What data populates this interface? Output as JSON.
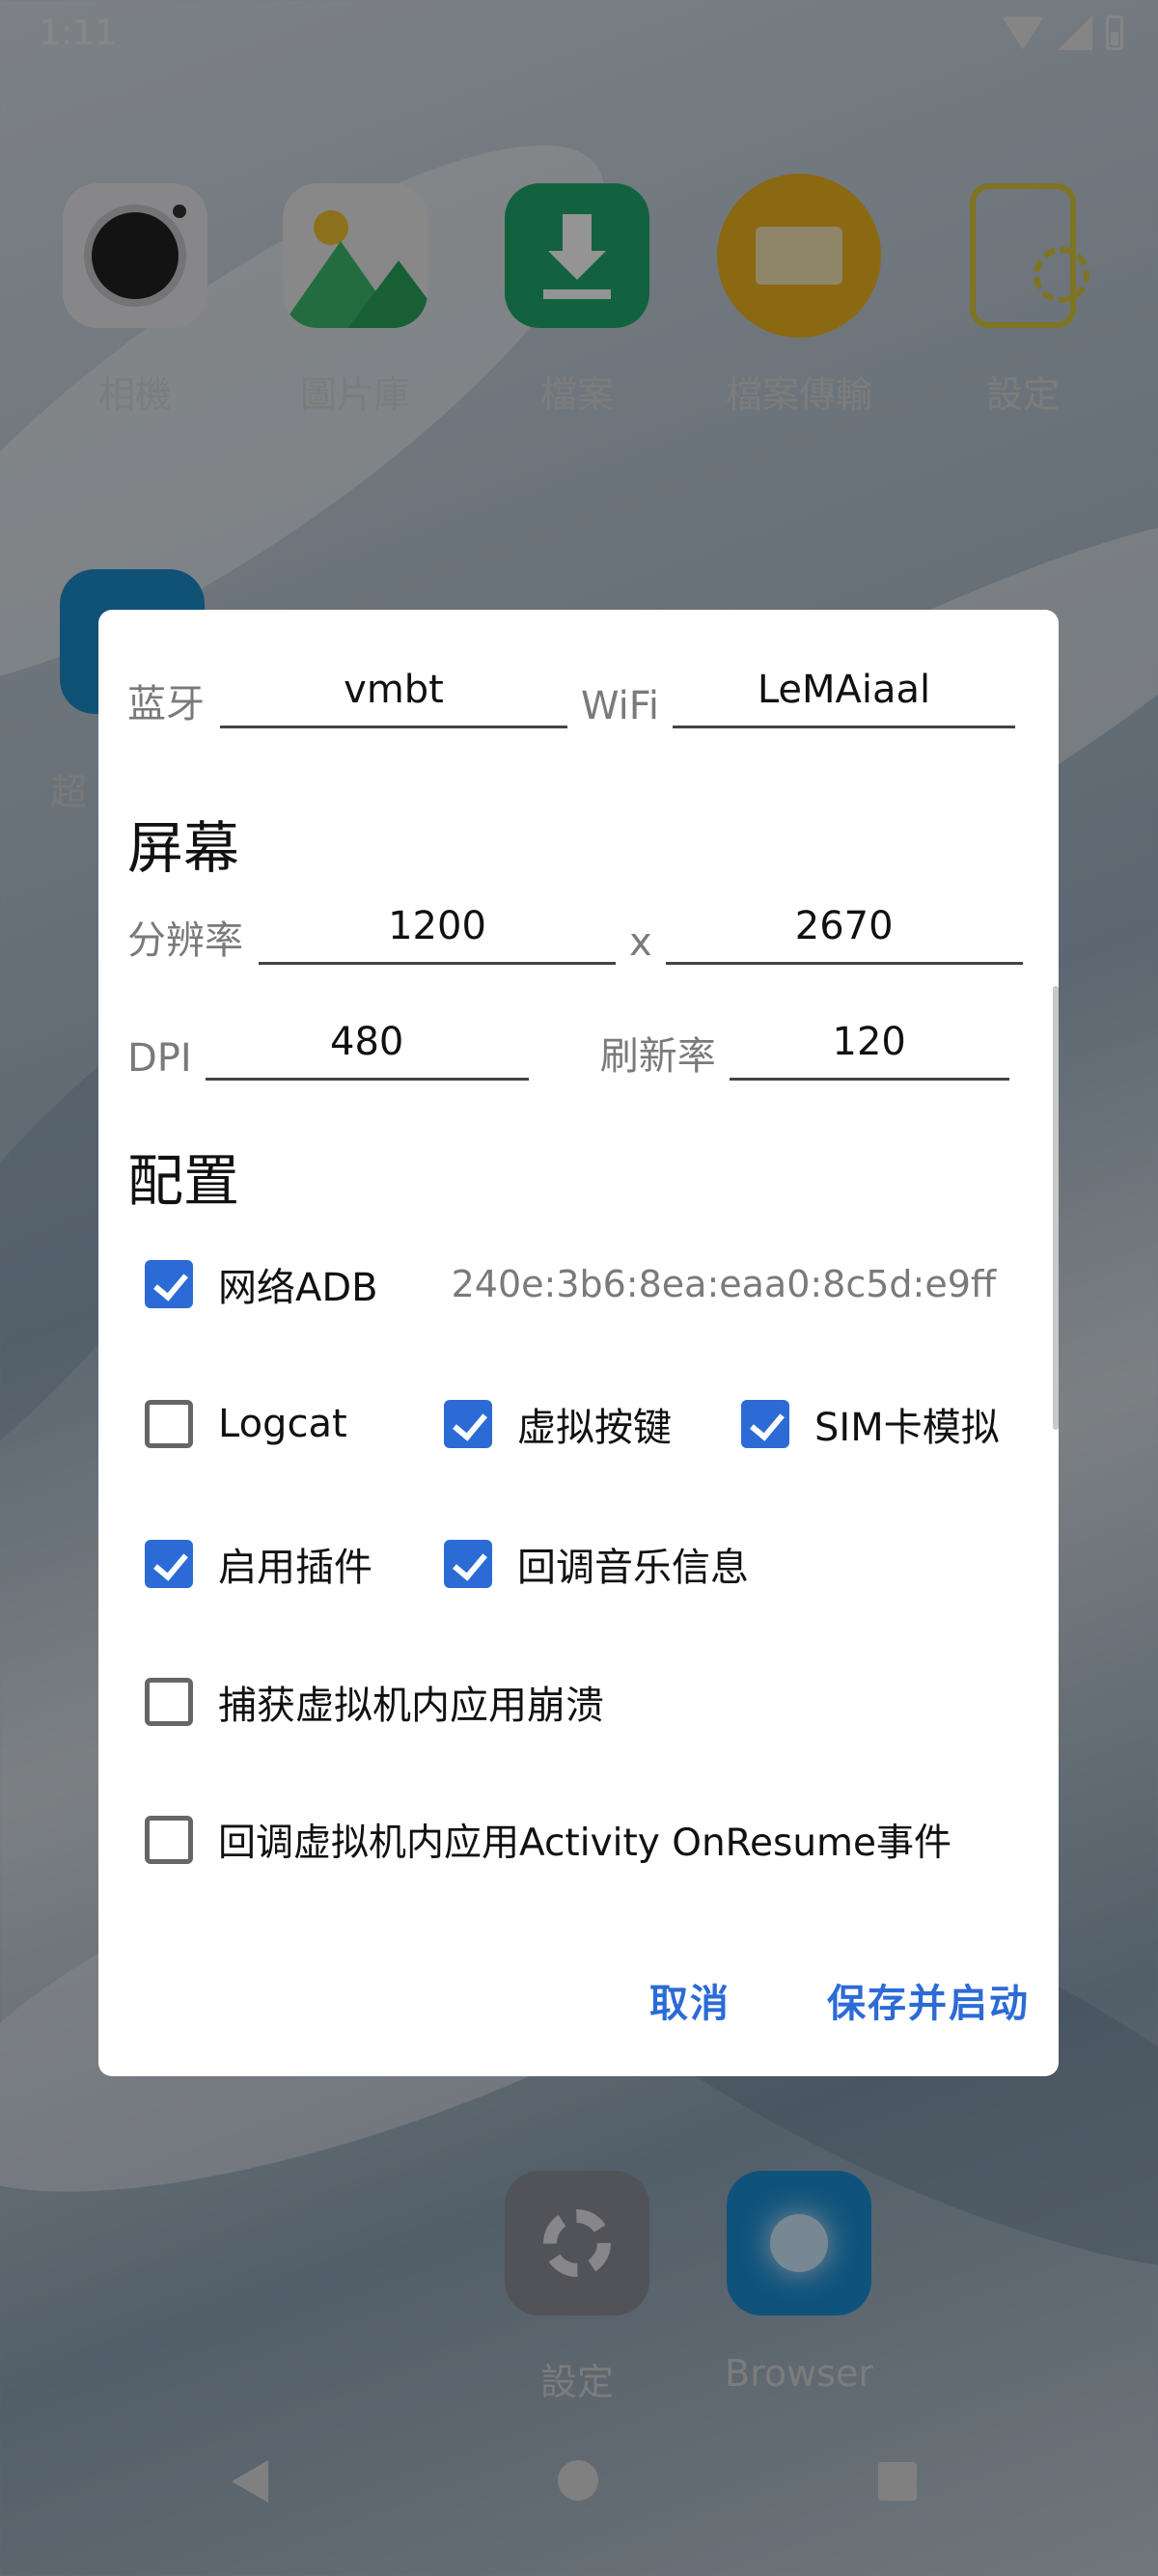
{
  "status_bar": {
    "time": "1:11"
  },
  "home_apps": [
    {
      "label": "相機",
      "icon": "camera-icon"
    },
    {
      "label": "圖片庫",
      "icon": "gallery-icon"
    },
    {
      "label": "檔案",
      "icon": "download-icon"
    },
    {
      "label": "檔案傳輸",
      "icon": "file-transfer-icon"
    },
    {
      "label": "設定",
      "icon": "settings-icon"
    }
  ],
  "partial_app_label": "超",
  "dock_apps": [
    {
      "label": "設定",
      "icon": "gear-icon"
    },
    {
      "label": "Browser",
      "icon": "browser-icon"
    }
  ],
  "dialog": {
    "bluetooth_label": "蓝牙",
    "bluetooth_value": "vmbt",
    "wifi_label": "WiFi",
    "wifi_value": "LeMAiaal",
    "screen_title": "屏幕",
    "resolution_label": "分辨率",
    "width_value": "1200",
    "x_label": "x",
    "height_value": "2670",
    "dpi_label": "DPI",
    "dpi_value": "480",
    "refresh_label": "刷新率",
    "refresh_value": "120",
    "config_title": "配置",
    "options": {
      "network_adb": {
        "label": "网络ADB",
        "checked": true
      },
      "adb_address": "240e:3b6:8ea:eaa0:8c5d:e9ff",
      "logcat": {
        "label": "Logcat",
        "checked": false
      },
      "virtual_keys": {
        "label": "虚拟按键",
        "checked": true
      },
      "sim_emulation": {
        "label": "SIM卡模拟",
        "checked": true
      },
      "enable_plugins": {
        "label": "启用插件",
        "checked": true
      },
      "music_callback": {
        "label": "回调音乐信息",
        "checked": true
      },
      "catch_crash": {
        "label": "捕获虚拟机内应用崩溃",
        "checked": false
      },
      "activity_callback": {
        "label": "回调虚拟机内应用Activity OnResume事件",
        "checked": false
      }
    },
    "cancel_label": "取消",
    "save_label": "保存并启动"
  },
  "colors": {
    "accent": "#2c6bd6",
    "scrim": "rgba(0,0,0,0.42)"
  }
}
